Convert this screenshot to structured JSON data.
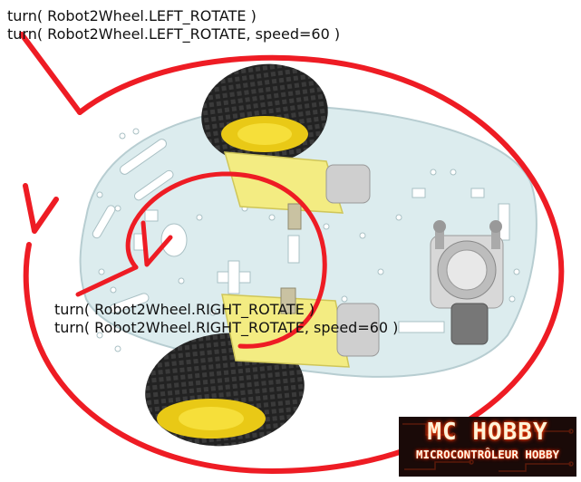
{
  "labels": {
    "left_rotate": "turn( Robot2Wheel.LEFT_ROTATE )",
    "left_rotate_speed": "turn( Robot2Wheel.LEFT_ROTATE, speed=60 )",
    "right_rotate": "turn( Robot2Wheel.RIGHT_ROTATE )",
    "right_rotate_speed": "turn( Robot2Wheel.RIGHT_ROTATE, speed=60 )"
  },
  "logo": {
    "line1": "MC HOBBY",
    "line2": "MICROCONTRÔLEUR HOBBY"
  },
  "colors": {
    "arrow": "#ee1c24",
    "chassis": "#dfeef0",
    "tire": "#1e1e1e",
    "hub": "#f2d61a",
    "motor": "#f5ef8a",
    "logo_bg": "#1a0a08",
    "logo_glow": "#ff4a00"
  }
}
